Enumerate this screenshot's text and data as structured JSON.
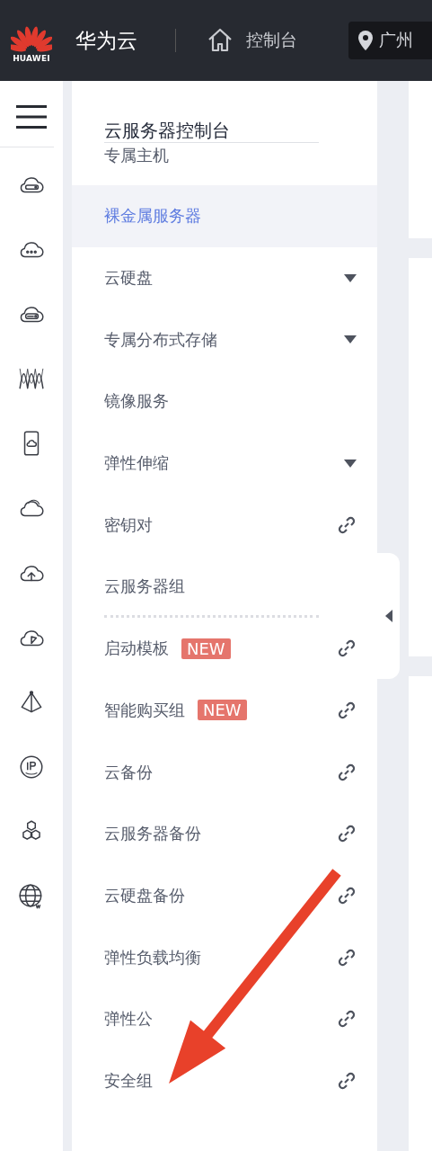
{
  "header": {
    "logo_text": "HUAWEI",
    "brand": "华为云",
    "console_link": "控制台",
    "region": "广州"
  },
  "menu": {
    "title": "云服务器控制台",
    "items": [
      {
        "label": "专属主机",
        "kind": "plain",
        "selected": false
      },
      {
        "label": "裸金属服务器",
        "kind": "plain",
        "selected": true
      },
      {
        "label": "云硬盘",
        "kind": "expand",
        "selected": false
      },
      {
        "label": "专属分布式存储",
        "kind": "expand",
        "selected": false
      },
      {
        "label": "镜像服务",
        "kind": "plain",
        "selected": false
      },
      {
        "label": "弹性伸缩",
        "kind": "expand",
        "selected": false
      },
      {
        "label": "密钥对",
        "kind": "link",
        "selected": false
      },
      {
        "label": "云服务器组",
        "kind": "plain",
        "selected": false
      },
      {
        "kind": "separator"
      },
      {
        "label": "启动模板",
        "kind": "link",
        "selected": false,
        "badge": "NEW"
      },
      {
        "label": "智能购买组",
        "kind": "link",
        "selected": false,
        "badge": "NEW"
      },
      {
        "label": "云备份",
        "kind": "link",
        "selected": false
      },
      {
        "label": "云服务器备份",
        "kind": "link",
        "selected": false
      },
      {
        "label": "云硬盘备份",
        "kind": "link",
        "selected": false
      },
      {
        "label": "弹性负载均衡",
        "kind": "link",
        "selected": false
      },
      {
        "label": "弹性公",
        "kind": "link",
        "selected": false
      },
      {
        "label": "安全组",
        "kind": "link",
        "selected": false
      }
    ]
  }
}
